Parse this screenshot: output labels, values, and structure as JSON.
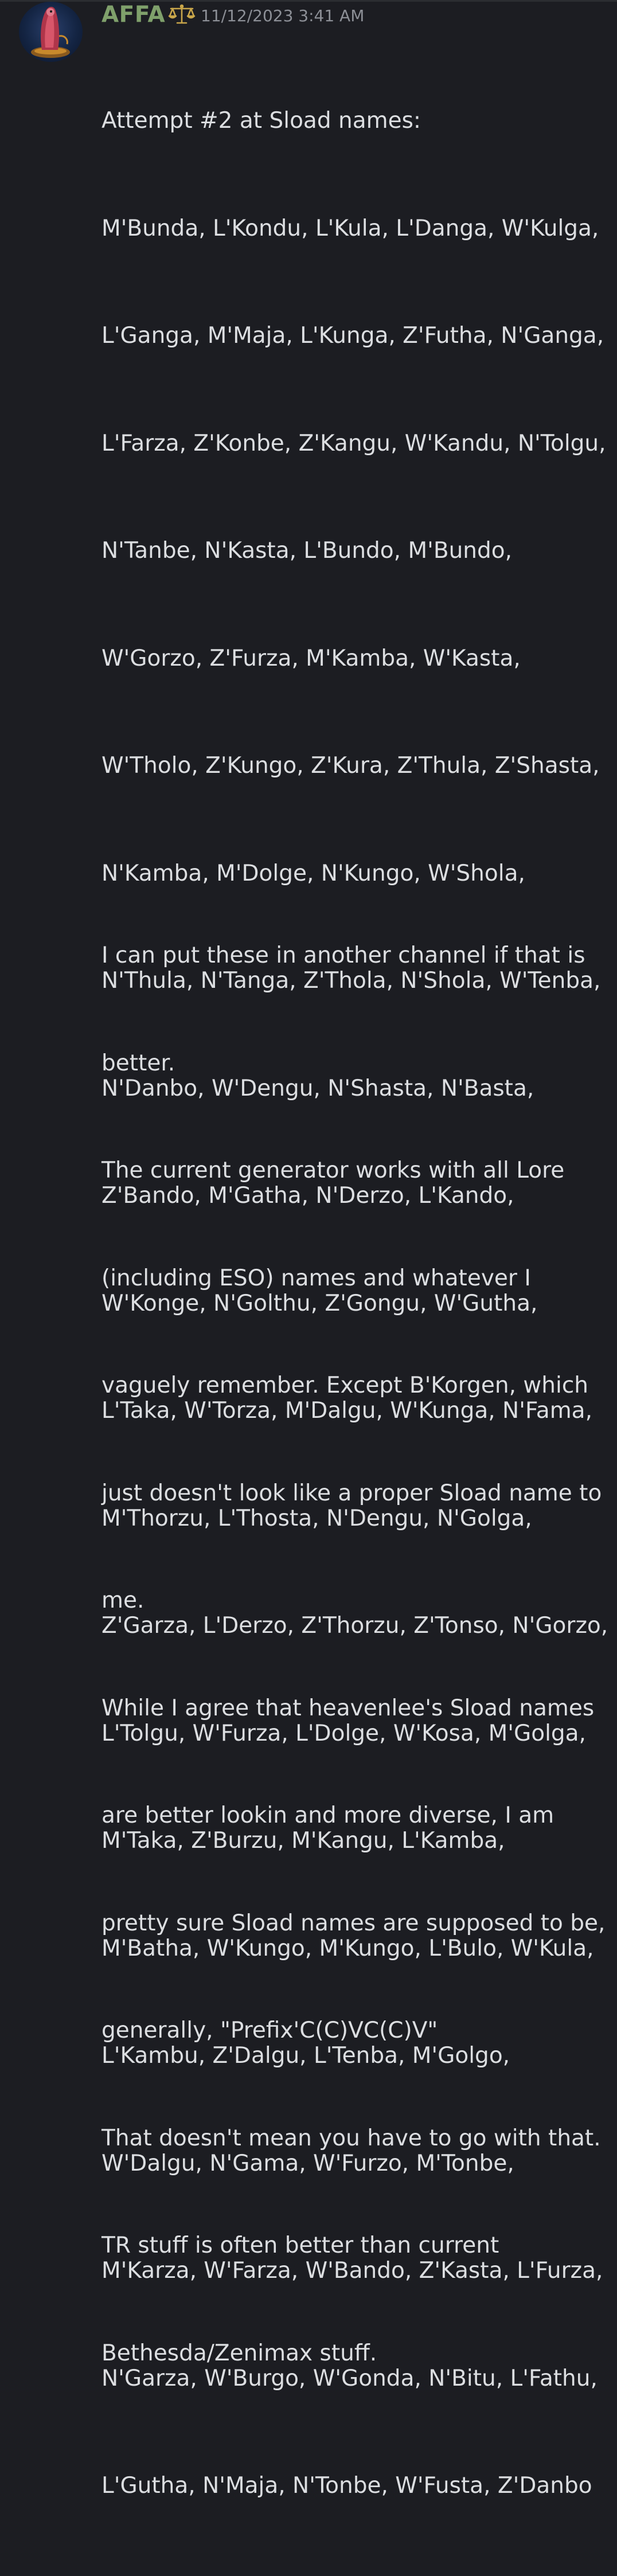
{
  "message": {
    "author": "AFFA",
    "timestamp": "11/12/2023 3:41 AM",
    "role_icon": "scales-icon",
    "colors": {
      "background": "#1c1d22",
      "username": "#7fa06b",
      "text": "#dcdee1",
      "timestamp": "#8c8f96",
      "role_icon": "#c9a64a"
    },
    "paragraph_1": [
      "Attempt #2 at Sload names:",
      "M'Bunda, L'Kondu, L'Kula, L'Danga, W'Kulga,",
      "L'Ganga, M'Maja, L'Kunga, Z'Futha, N'Ganga,",
      "L'Farza, Z'Konbe, Z'Kangu, W'Kandu, N'Tolgu,",
      "N'Tanbe, N'Kasta, L'Bundo, M'Bundo,",
      "W'Gorzo, Z'Furza, M'Kamba, W'Kasta,",
      "W'Tholo, Z'Kungo, Z'Kura, Z'Thula, Z'Shasta,",
      "N'Kamba, M'Dolge, N'Kungo, W'Shola,",
      "N'Thula, N'Tanga, Z'Thola, N'Shola, W'Tenba,",
      "N'Danbo, W'Dengu, N'Shasta, N'Basta,",
      "Z'Bando, M'Gatha, N'Derzo, L'Kando,",
      "W'Konge, N'Golthu, Z'Gongu, W'Gutha,",
      "L'Taka, W'Torza, M'Dalgu, W'Kunga, N'Fama,",
      "M'Thorzu, L'Thosta, N'Dengu, N'Golga,",
      "Z'Garza, L'Derzo, Z'Thorzu, Z'Tonso, N'Gorzo,",
      "L'Tolgu, W'Furza, L'Dolge, W'Kosa, M'Golga,",
      "M'Taka, Z'Burzu, M'Kangu, L'Kamba,",
      "M'Batha, W'Kungo, M'Kungo, L'Bulo, W'Kula,",
      "L'Kambu, Z'Dalgu, L'Tenba, M'Golgo,",
      "W'Dalgu, N'Gama, W'Furzo, M'Tonbe,",
      "M'Karza, W'Farza, W'Bando, Z'Kasta, L'Furza,",
      "N'Garza, W'Burgo, W'Gonda, N'Bitu, L'Fathu,",
      "L'Gutha, N'Maja, N'Tonbe, W'Fusta, Z'Danbo"
    ],
    "paragraph_2": [
      "I can put these in another channel if that is",
      "better.",
      "The current generator works with all Lore",
      "(including ESO) names and whatever I",
      "vaguely remember. Except B'Korgen, which",
      "just doesn't look like a proper Sload name to",
      "me.",
      "While I agree that heavenlee's Sload names",
      "are better lookin and more diverse, I am",
      "pretty sure Sload names are supposed to be,",
      "generally, \"Prefix'C(C)VC(C)V\"",
      "That doesn't mean you have to go with that.",
      "TR stuff is often better than current",
      "Bethesda/Zenimax stuff."
    ]
  }
}
